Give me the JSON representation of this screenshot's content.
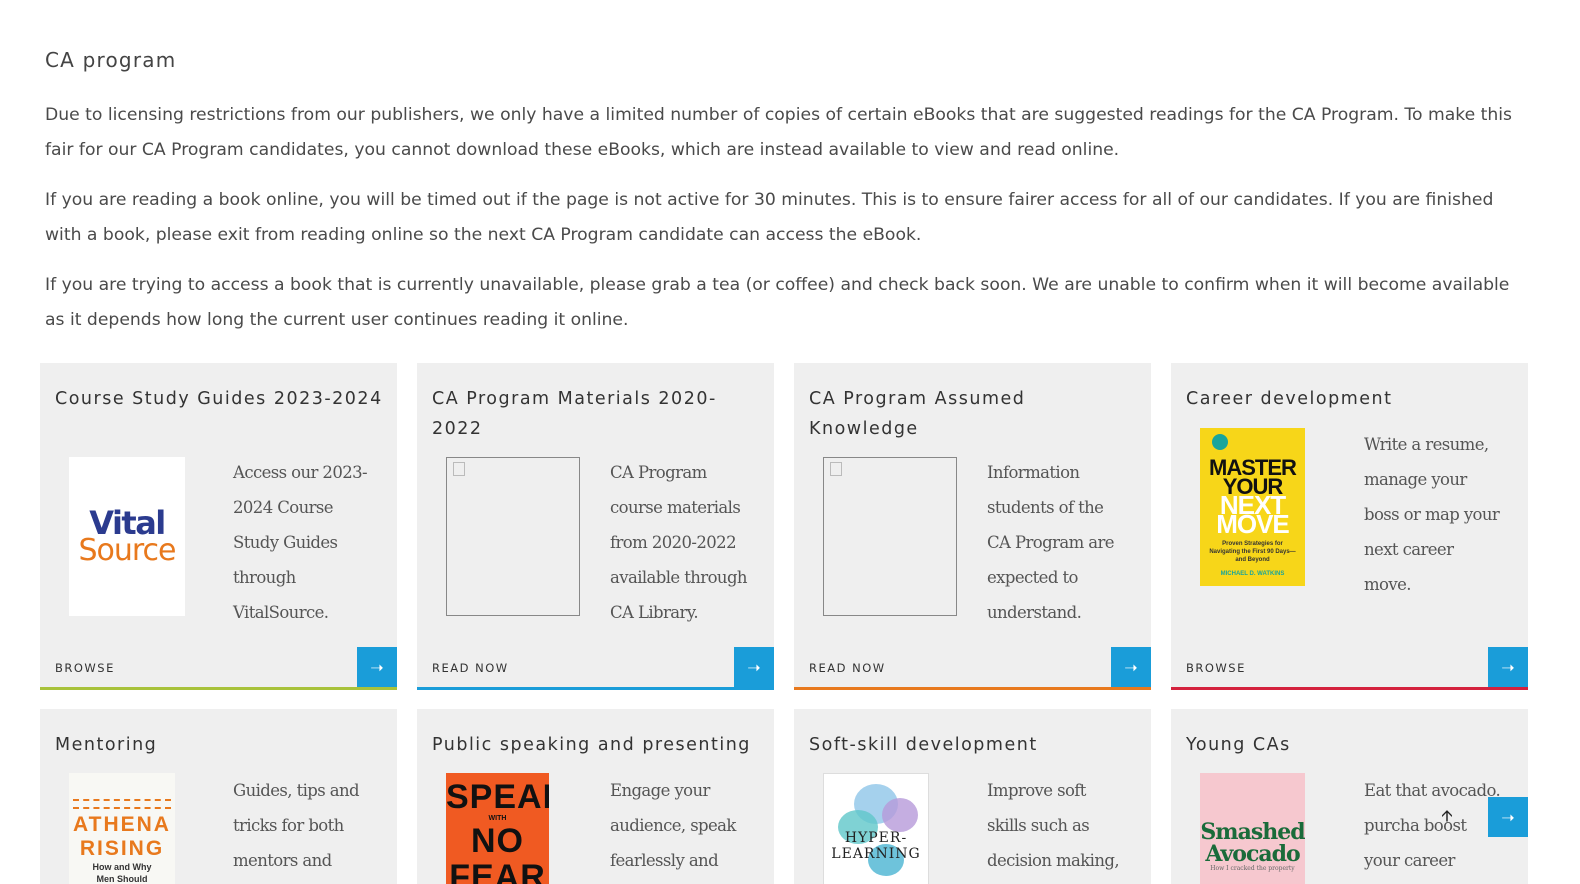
{
  "section": {
    "title": "CA program"
  },
  "intro": {
    "p1": "Due to licensing restrictions from our publishers, we only have a limited number of copies of certain eBooks that are suggested readings for the CA Program. To make this fair for our CA Program candidates, you cannot download these eBooks, which are instead available to view and read online.",
    "p2": "If you are reading a book online, you will be timed out if the page is not active for 30 minutes. This is to ensure fairer access for all of our candidates. If you are finished with a book, please exit from reading online so the next CA Program candidate can access the eBook.",
    "p3": "If you are trying to access a book that is currently unavailable, please grab a tea (or coffee) and check back soon. We are unable to confirm when it will become available as it depends how long the current user continues reading it online."
  },
  "cards": [
    {
      "title": "Course Study Guides 2023-2024",
      "desc": "Access our 2023-2024 Course Study Guides through VitalSource.",
      "action": "BROWSE",
      "accent": "#a8c23a",
      "cover": {
        "line1": "Vital",
        "line2": "Source"
      }
    },
    {
      "title": "CA Program Materials 2020-2022",
      "desc": "CA Program course materials from 2020-2022 available through CA Library.",
      "action": "READ NOW",
      "accent": "#1a9dd9"
    },
    {
      "title": "CA Program Assumed Knowledge",
      "desc": "Information students of the CA Program are expected to understand.",
      "action": "READ NOW",
      "accent": "#e8791d"
    },
    {
      "title": "Career development",
      "desc": "Write a resume, manage your boss or map your next career move.",
      "action": "BROWSE",
      "accent": "#d4213d",
      "cover": {
        "line1": "MASTER YOUR",
        "line2": "NEXT MOVE",
        "line3": "Proven Strategies for Navigating the First 90 Days—and Beyond",
        "line4": "MICHAEL D. WATKINS"
      }
    },
    {
      "title": "Mentoring",
      "desc": "Guides, tips and tricks for both mentors and",
      "cover": {
        "line1": "ATHENA",
        "line2": "RISING",
        "line3": "How and Why",
        "line4": "Men Should"
      }
    },
    {
      "title": "Public speaking and presenting",
      "desc": "Engage your audience, speak fearlessly and",
      "cover": {
        "line1": "SPEAK",
        "line2": "WITH",
        "line3": "NO FEAR"
      }
    },
    {
      "title": "Soft-skill development",
      "desc": "Improve soft skills such as decision making, learning",
      "cover": {
        "line1": "HYPER-",
        "line2": "LEARNING"
      }
    },
    {
      "title": "Young CAs",
      "desc": "Eat that avocado. purcha boost your career",
      "cover": {
        "line1": "Smashed",
        "line2": "Avocado",
        "line3": "How I cracked the property"
      }
    }
  ],
  "icons": {
    "arrow": "arrow-right-icon",
    "scroll": "arrow-up-icon"
  },
  "colors": {
    "button": "#1a9dd9"
  }
}
